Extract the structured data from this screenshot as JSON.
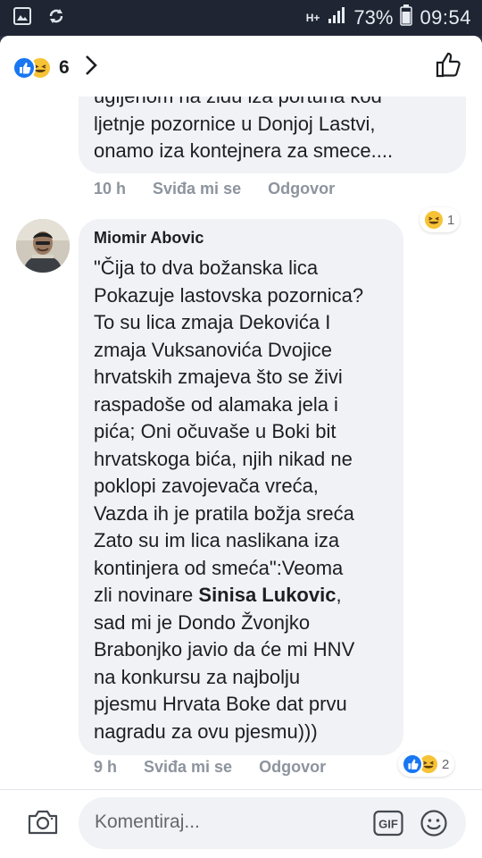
{
  "status_bar": {
    "network": "H+",
    "battery_percent": "73%",
    "time": "09:54",
    "icons": [
      "gallery-icon",
      "sync-icon",
      "signal-icon",
      "battery-icon"
    ]
  },
  "header": {
    "reaction_count": "6",
    "reactions": [
      "like",
      "haha"
    ]
  },
  "comments": [
    {
      "text": "ugljenom na zidu iza portuna kod\nljetnje pozornice u Donjoj Lastvi,\nonamo iza kontejnera za smece....",
      "time": "10 h",
      "like_label": "Sviđa mi se",
      "reply_label": "Odgovor",
      "reaction_count": "1"
    },
    {
      "author": "Miomir Abovic",
      "text_before": "\"Čija to dva božanska lica\nPokazuje lastovska pozornica?\nTo su lica zmaja Dekovića I\nzmaja Vuksanovića Dvojice\nhrvatskih zmajeva što se živi\nraspadoše od alamaka jela i\npića; Oni očuvaše u Boki bit\nhrvatskoga bića, njih nikad ne\npoklopi zavojevača vreća,\nVazda ih je pratila božja sreća\nZato su im lica naslikana iza\nkontinjera od smeća\":Veoma\nzli novinare ",
      "mention": "Sinisa Lukovic",
      "text_after": ",\nsad mi je Dondo Žvonjko\nBrabonjko javio da će mi HNV\nna konkursu za najbolju\npjesmu Hrvata Boke dat prvu\nnagradu za ovu pjesmu)))",
      "time": "9 h",
      "like_label": "Sviđa mi se",
      "reply_label": "Odgovor",
      "reaction_count": "2"
    }
  ],
  "composer": {
    "placeholder": "Komentiraj...",
    "gif_label": "GIF"
  },
  "colors": {
    "like_blue": "#1877f2",
    "haha_yellow": "#f7c336",
    "bubble": "#f0f2f5",
    "meta_gray": "#8d949e"
  }
}
